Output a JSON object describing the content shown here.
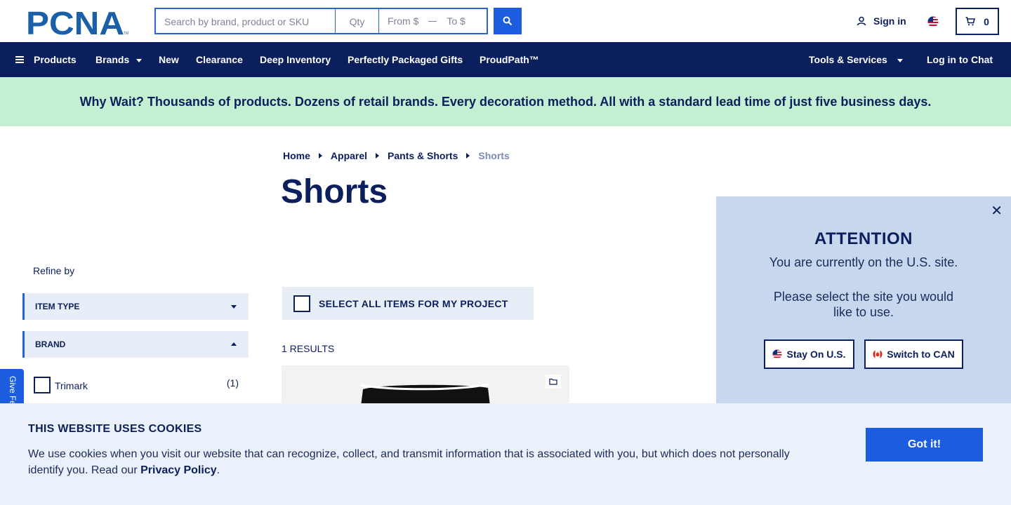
{
  "header": {
    "logo_text": "PCNA",
    "search_placeholder": "Search by brand, product or SKU",
    "qty_placeholder": "Qty",
    "price_from_placeholder": "From $",
    "price_to_placeholder": "To $",
    "sign_in": "Sign in",
    "cart_count": "0",
    "icons": {
      "search": "search-icon",
      "user": "user-icon",
      "flag": "us-flag-icon",
      "cart": "cart-icon"
    }
  },
  "nav": {
    "products": "Products",
    "brands": "Brands",
    "new": "New",
    "clearance": "Clearance",
    "deep_inventory": "Deep Inventory",
    "gifts": "Perfectly Packaged Gifts",
    "proudpath": "ProudPath™",
    "tools": "Tools & Services",
    "chat": "Log in to Chat"
  },
  "promo": {
    "text": "Why Wait? Thousands of products. Dozens of retail brands. Every decoration method. All with a standard lead time of just five business days."
  },
  "breadcrumb": [
    "Home",
    "Apparel",
    "Pants & Shorts",
    "Shorts"
  ],
  "page_title": "Shorts",
  "sidebar": {
    "refine_label": "Refine by",
    "facets": [
      {
        "label": "ITEM TYPE",
        "expanded": false
      },
      {
        "label": "BRAND",
        "expanded": true
      }
    ],
    "brand_options": [
      {
        "label": "Trimark",
        "count": "(1)"
      }
    ]
  },
  "feedback_tab": "Give Feedback",
  "results": {
    "select_all": "SELECT ALL ITEMS FOR MY PROJECT",
    "count_label": "1 RESULTS"
  },
  "region_modal": {
    "heading": "ATTENTION",
    "line1": "You are currently on the U.S. site.",
    "line2": "Please select the site you would like to use.",
    "stay_button": "Stay On U.S.",
    "switch_button": "Switch to CAN"
  },
  "cookies": {
    "title": "THIS WEBSITE USES COOKIES",
    "body": "We use cookies when you visit our website that can recognize, collect, and transmit information that is associated with you, but which does not personally identify you. Read our",
    "link": "Privacy Policy",
    "period": ".",
    "button": "Got it!"
  },
  "colors": {
    "navy": "#0b1f5c",
    "blue_accent": "#1c5de0",
    "promo_green": "#c3efd2",
    "facet_bg": "#e8eef7",
    "modal_bg": "#c6d7ee",
    "cookie_bg": "#ebf1fa"
  }
}
